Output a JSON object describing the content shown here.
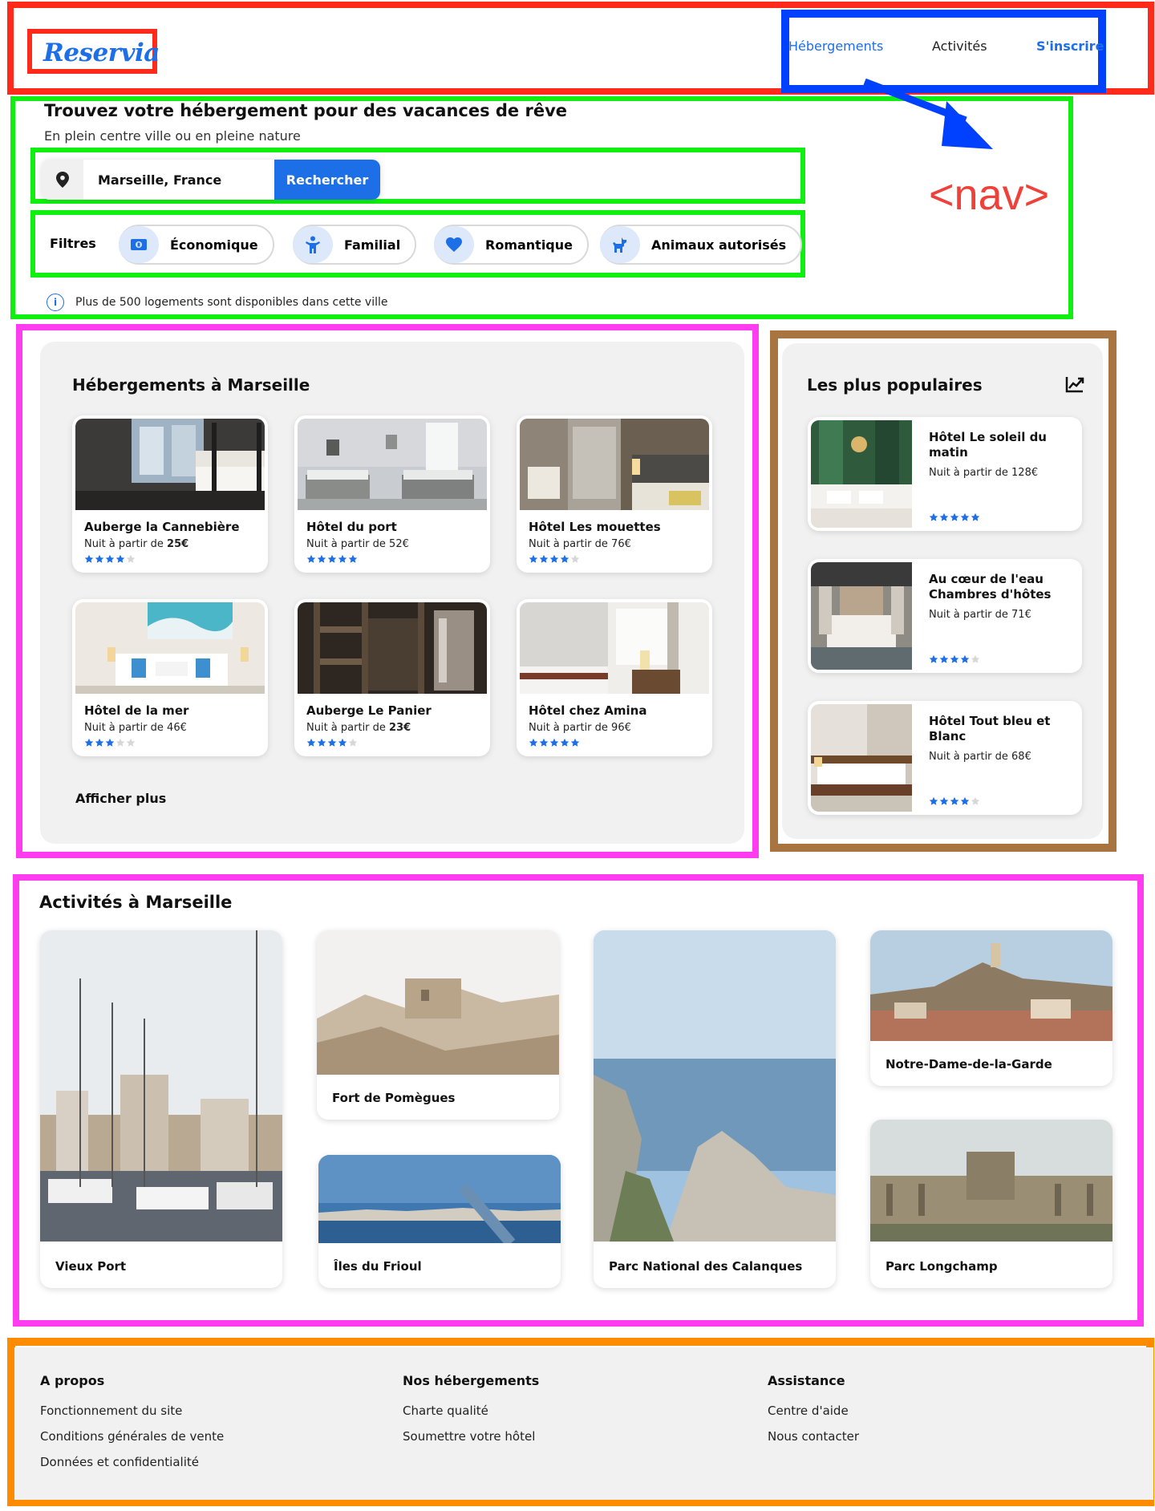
{
  "header": {
    "logo": "Reservia",
    "nav": {
      "stays": "Hébergements",
      "activities": "Activités",
      "signup": "S'inscrire"
    },
    "nav_annotation": "<nav>"
  },
  "search": {
    "title": "Trouvez votre hébergement pour des vacances de rêve",
    "subtitle": "En plein centre ville ou en pleine nature",
    "location_value": "Marseille, France",
    "button": "Rechercher",
    "filters_label": "Filtres",
    "filters": [
      "Économique",
      "Familial",
      "Romantique",
      "Animaux autorisés"
    ],
    "info": "Plus de 500 logements sont disponibles dans cette ville"
  },
  "accommodations": {
    "title": "Hébergements à Marseille",
    "price_prefix": "Nuit à partir de",
    "items": [
      {
        "name": "Auberge la Cannebière",
        "price": "25€",
        "rating": 4
      },
      {
        "name": "Hôtel du port",
        "price": "52€",
        "rating": 5
      },
      {
        "name": "Hôtel Les mouettes",
        "price": "76€",
        "rating": 4
      },
      {
        "name": "Hôtel de la mer",
        "price": "46€",
        "rating": 3
      },
      {
        "name": "Auberge Le Panier",
        "price": "23€",
        "rating": 4
      },
      {
        "name": "Hôtel chez Amina",
        "price": "96€",
        "rating": 5
      }
    ],
    "show_more": "Afficher plus"
  },
  "popular": {
    "title": "Les plus populaires",
    "items": [
      {
        "name": "Hôtel Le soleil du matin",
        "price_text": "Nuit à partir de 128€",
        "rating": 5
      },
      {
        "name": "Au cœur de l'eau Chambres d'hôtes",
        "price_text": "Nuit à partir de 71€",
        "rating": 4
      },
      {
        "name": "Hôtel Tout bleu et Blanc",
        "price_text": "Nuit à partir de 68€",
        "rating": 4
      }
    ]
  },
  "activities": {
    "title": "Activités à Marseille",
    "items": [
      "Vieux Port",
      "Fort de Pomègues",
      "Îles du Frioul",
      "Parc National des Calanques",
      "Notre-Dame-de-la-Garde",
      "Parc Longchamp"
    ]
  },
  "footer": {
    "columns": [
      {
        "title": "A propos",
        "links": [
          "Fonctionnement du site",
          "Conditions générales de vente",
          "Données et confidentialité"
        ]
      },
      {
        "title": "Nos hébergements",
        "links": [
          "Charte qualité",
          "Soumettre votre hôtel"
        ]
      },
      {
        "title": "Assistance",
        "links": [
          "Centre d'aide",
          "Nous contacter"
        ]
      }
    ]
  },
  "colors": {
    "brand_blue": "#1d6fe8",
    "panel_gray": "#f1f1f1",
    "annot_red": "#f0403a",
    "annot_blue": "#0040ff",
    "annot_green": "#10f010",
    "annot_magenta": "#ff3cf0",
    "annot_brown": "#a87440",
    "annot_orange": "#ff8c00"
  },
  "icons": [
    "location-pin-icon",
    "money-icon",
    "family-icon",
    "heart-icon",
    "pet-icon",
    "info-icon",
    "trending-up-icon",
    "star-icon"
  ]
}
